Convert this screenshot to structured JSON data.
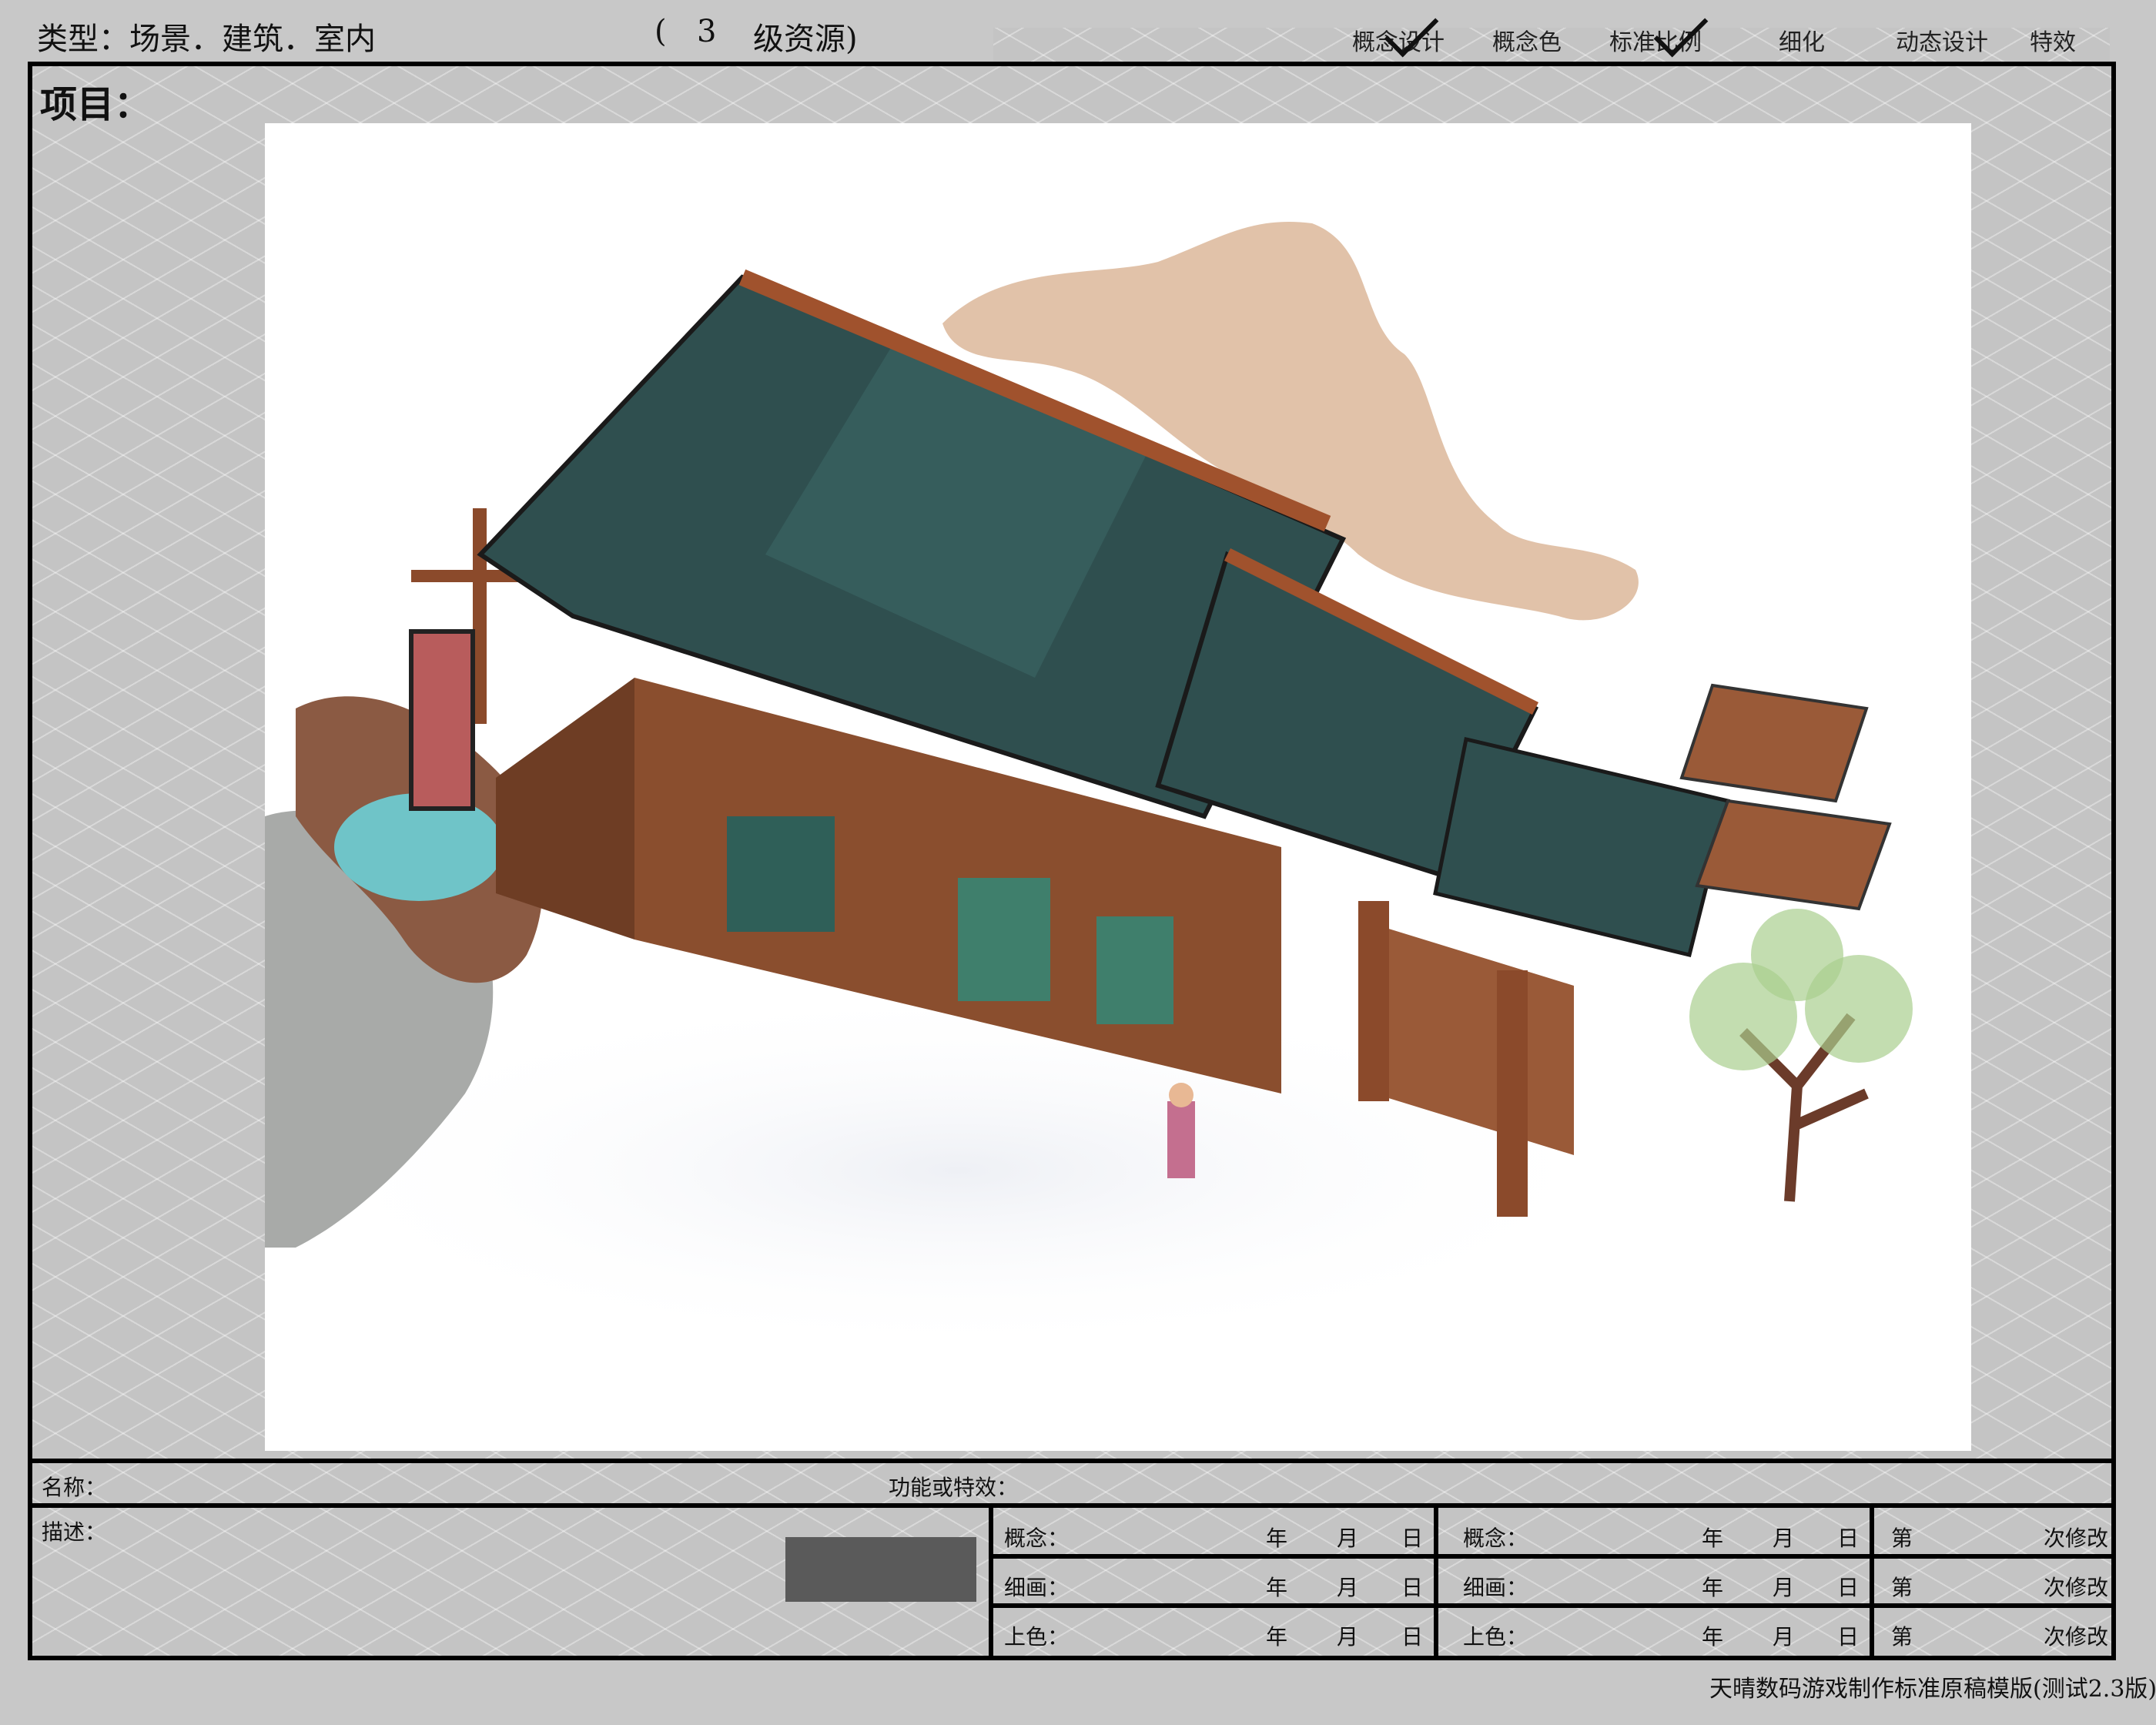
{
  "header": {
    "type_label": "类型：",
    "type_value": "场景．建筑．室内",
    "paren_open": "(",
    "level_number": "3",
    "level_text": "级资源)",
    "stages": [
      "概念设计",
      "概念色",
      "标准比例",
      "细化",
      "动态设计",
      "特效"
    ],
    "stages_checked": [
      true,
      false,
      true,
      false,
      false,
      false
    ]
  },
  "project_label": "项目：",
  "artwork": {
    "description_icon": "isometric-temple-illustration",
    "colors": {
      "roof": "#2f4f4f",
      "wood": "#a0522d",
      "accent": "#3fa58a",
      "smoke": "#c89062"
    }
  },
  "info": {
    "name_label": "名称：",
    "function_label": "功能或特效：",
    "desc_label": "描述："
  },
  "table": {
    "left": [
      {
        "label": "概念：",
        "year": "年",
        "month": "月",
        "day": "日"
      },
      {
        "label": "细画：",
        "year": "年",
        "month": "月",
        "day": "日"
      },
      {
        "label": "上色：",
        "year": "年",
        "month": "月",
        "day": "日"
      }
    ],
    "right": [
      {
        "label": "概念：",
        "year": "年",
        "month": "月",
        "day": "日"
      },
      {
        "label": "细画：",
        "year": "年",
        "month": "月",
        "day": "日"
      },
      {
        "label": "上色：",
        "year": "年",
        "month": "月",
        "day": "日"
      }
    ],
    "revisions": [
      {
        "prefix": "第",
        "suffix": "次修改"
      },
      {
        "prefix": "第",
        "suffix": "次修改"
      },
      {
        "prefix": "第",
        "suffix": "次修改"
      }
    ]
  },
  "footer": "天晴数码游戏制作标准原稿模版(测试2.3版)"
}
